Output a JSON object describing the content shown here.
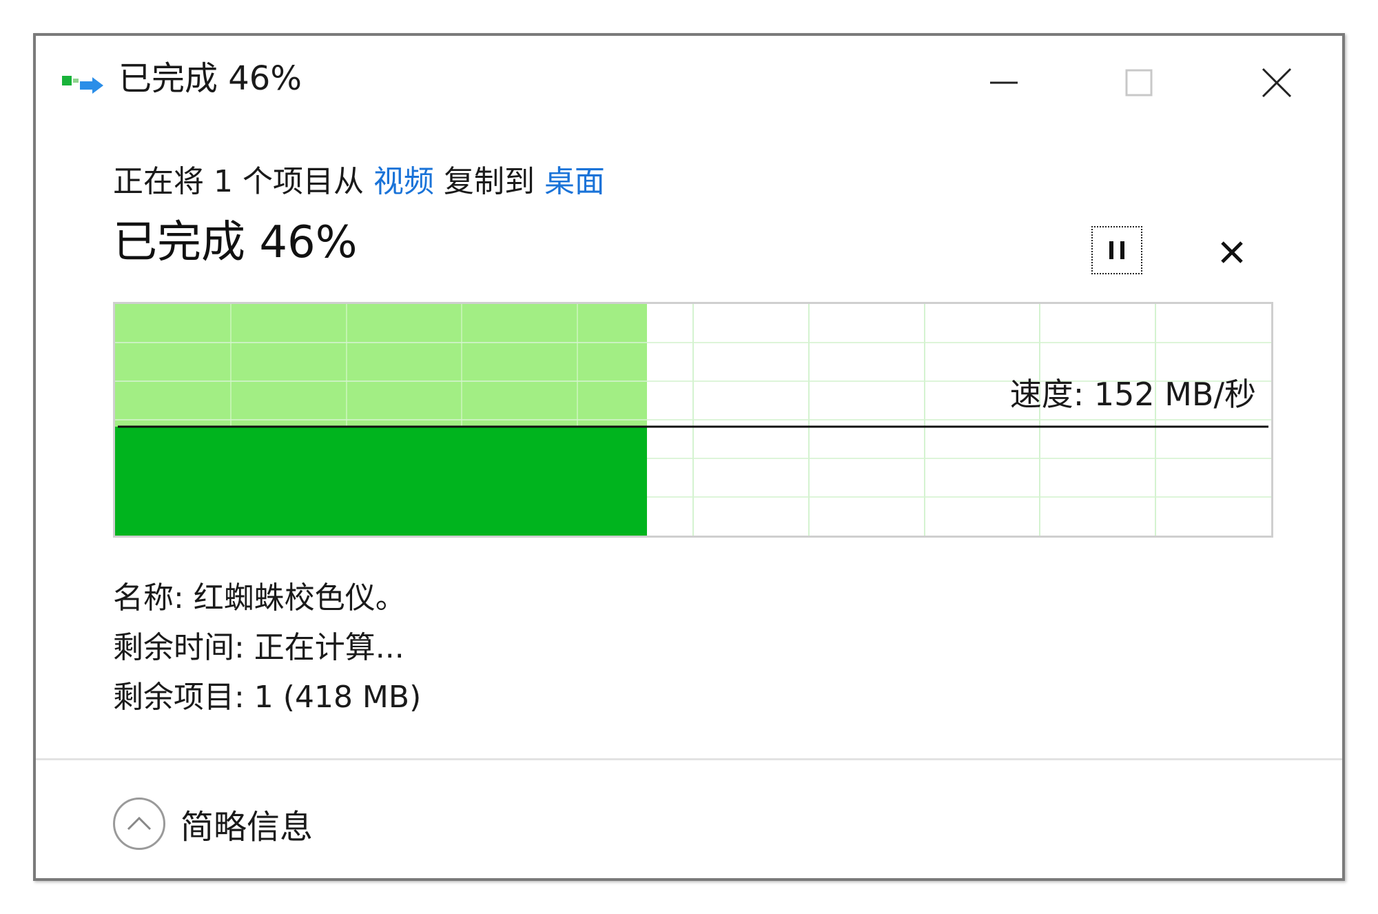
{
  "window": {
    "title": "已完成 46%",
    "minimize_label": "",
    "maximize_label": "",
    "close_label": ""
  },
  "transfer": {
    "prefix": "正在将 1 个项目从 ",
    "source": "视频",
    "middle": " 复制到 ",
    "destination": "桌面",
    "status": "已完成 46%",
    "progress_percent": 46
  },
  "graph": {
    "speed_label": "速度: 152 MB/秒"
  },
  "details": {
    "name": "名称: 红蜘蛛校色仪。",
    "time_remaining": "剩余时间: 正在计算...",
    "items_remaining": "剩余项目: 1 (418 MB)"
  },
  "footer": {
    "toggle_label": "简略信息"
  },
  "colors": {
    "progress_light": "#a2ee84",
    "progress_dark": "#00b41e",
    "grid_line": "#d4f3d0",
    "link": "#1a73d8"
  },
  "icons": {
    "app": "copy-transfer-icon",
    "pause": "pause-icon",
    "cancel": "close-icon",
    "toggle": "chevron-up-icon"
  }
}
